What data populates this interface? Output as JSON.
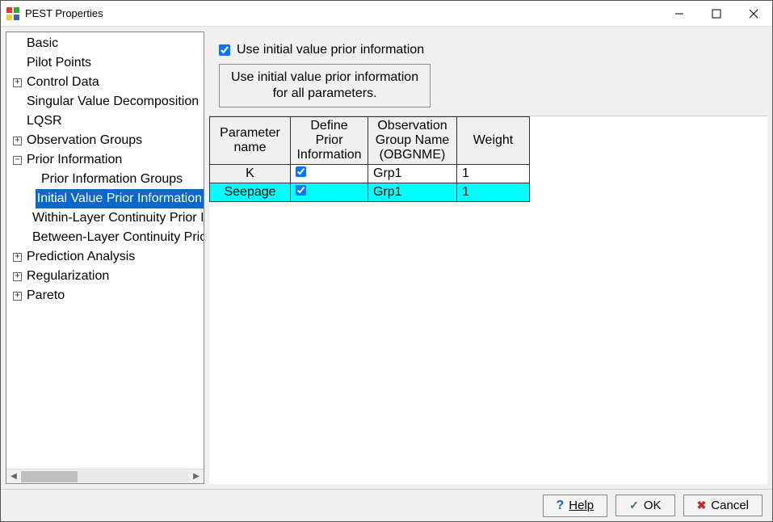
{
  "window": {
    "title": "PEST Properties"
  },
  "tree": {
    "items": [
      {
        "level": 0,
        "expander": "none",
        "label": "Basic",
        "selected": false
      },
      {
        "level": 0,
        "expander": "none",
        "label": "Pilot Points",
        "selected": false
      },
      {
        "level": 0,
        "expander": "plus",
        "label": "Control Data",
        "selected": false
      },
      {
        "level": 0,
        "expander": "none",
        "label": "Singular Value Decomposition",
        "selected": false
      },
      {
        "level": 0,
        "expander": "none",
        "label": "LQSR",
        "selected": false
      },
      {
        "level": 0,
        "expander": "plus",
        "label": "Observation Groups",
        "selected": false
      },
      {
        "level": 0,
        "expander": "minus",
        "label": "Prior Information",
        "selected": false
      },
      {
        "level": 1,
        "expander": "none",
        "label": "Prior Information Groups",
        "selected": false
      },
      {
        "level": 1,
        "expander": "none",
        "label": "Initial Value Prior Information",
        "selected": true
      },
      {
        "level": 1,
        "expander": "none",
        "label": "Within-Layer Continuity Prior Information",
        "selected": false
      },
      {
        "level": 1,
        "expander": "none",
        "label": "Between-Layer Continuity Prior Information",
        "selected": false
      },
      {
        "level": 0,
        "expander": "plus",
        "label": "Prediction Analysis",
        "selected": false
      },
      {
        "level": 0,
        "expander": "plus",
        "label": "Regularization",
        "selected": false
      },
      {
        "level": 0,
        "expander": "plus",
        "label": "Pareto",
        "selected": false
      }
    ]
  },
  "top": {
    "checkbox_label": "Use initial value prior information",
    "checkbox_checked": true,
    "button_line1": "Use initial value prior information",
    "button_line2": "for all parameters."
  },
  "table": {
    "headers": {
      "param": "Parameter name",
      "define": "Define Prior Information",
      "obs": "Observation Group Name (OBGNME)",
      "weight": "Weight"
    },
    "rows": [
      {
        "name": "K",
        "define": true,
        "obs": "Grp1",
        "weight": "1",
        "highlight": false
      },
      {
        "name": "Seepage",
        "define": true,
        "obs": "Grp1",
        "weight": "1",
        "highlight": true
      }
    ]
  },
  "footer": {
    "help": "Help",
    "ok": "OK",
    "cancel": "Cancel"
  }
}
